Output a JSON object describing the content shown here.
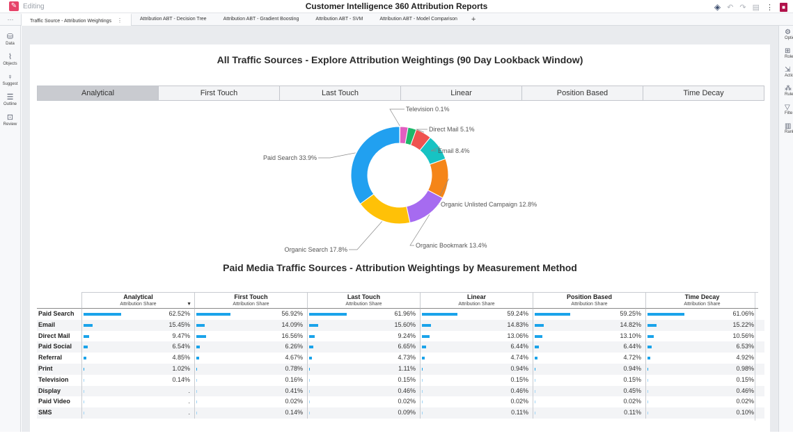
{
  "app": {
    "mode_label": "Editing",
    "title": "Customer Intelligence 360 Attribution Reports"
  },
  "tabs": [
    {
      "label": "Traffic Source - Attribution Weightings",
      "active": true
    },
    {
      "label": "Attribution ABT - Decision Tree",
      "active": false
    },
    {
      "label": "Attribution ABT - Gradient Boosting",
      "active": false
    },
    {
      "label": "Attribution ABT - SVM",
      "active": false
    },
    {
      "label": "Attribution ABT - Model Comparison",
      "active": false
    }
  ],
  "tab_add": "+",
  "left_rail": [
    {
      "icon": "data-icon",
      "glyph": "⛁",
      "label": "Data"
    },
    {
      "icon": "objects-icon",
      "glyph": "⌇",
      "label": "Objects"
    },
    {
      "icon": "suggest-icon",
      "glyph": "♀",
      "label": "Suggest"
    },
    {
      "icon": "outline-icon",
      "glyph": "☰",
      "label": "Outline"
    },
    {
      "icon": "review-icon",
      "glyph": "⊡",
      "label": "Review"
    }
  ],
  "right_rail": [
    {
      "icon": "options-icon",
      "glyph": "⚙",
      "label": "Optio"
    },
    {
      "icon": "roles-icon",
      "glyph": "⊞",
      "label": "Role"
    },
    {
      "icon": "actions-icon",
      "glyph": "⇲",
      "label": "Actio"
    },
    {
      "icon": "rules-icon",
      "glyph": "⁂",
      "label": "Rule"
    },
    {
      "icon": "filters-icon",
      "glyph": "▽",
      "label": "Filte"
    },
    {
      "icon": "ranks-icon",
      "glyph": "▥",
      "label": "Rank"
    }
  ],
  "report": {
    "title": "All Traffic Sources - Explore Attribution Weightings (90 Day Lookback Window)",
    "buttons": [
      "Analytical",
      "First Touch",
      "Last Touch",
      "Linear",
      "Position Based",
      "Time Decay"
    ],
    "selected_button": "Analytical",
    "table_title": "Paid Media Traffic Sources - Attribution Weightings by Measurement Method",
    "measure_label": "Attribution Share"
  },
  "chart_data": {
    "type": "pie",
    "donut": true,
    "slices": [
      {
        "label": "Paid Search",
        "value": 33.9,
        "display": "Paid Search 33.9%",
        "color": "#21a0f0"
      },
      {
        "label": "Organic Search",
        "value": 17.8,
        "display": "Organic Search 17.8%",
        "color": "#ffc107"
      },
      {
        "label": "Organic Bookmark",
        "value": 13.4,
        "display": "Organic Bookmark 13.4%",
        "color": "#a66bf0"
      },
      {
        "label": "Organic Unlisted Campaign",
        "value": 12.8,
        "display": "Organic Unlisted Campaign 12.8%",
        "color": "#f58518"
      },
      {
        "label": "Email",
        "value": 8.4,
        "display": "Email 8.4%",
        "color": "#17c3c3"
      },
      {
        "label": "Direct Mail",
        "value": 5.1,
        "display": "Direct Mail 5.1%",
        "color": "#ef5350"
      },
      {
        "label": "Other 1",
        "value": 2.7,
        "display": "",
        "color": "#1db86a"
      },
      {
        "label": "Other 2",
        "value": 2.6,
        "display": "",
        "color": "#e15fc0"
      },
      {
        "label": "Television",
        "value": 0.1,
        "display": "Television 0.1%",
        "color": "#c6d33a"
      }
    ]
  },
  "table": {
    "columns": [
      "Analytical",
      "First Touch",
      "Last Touch",
      "Linear",
      "Position Based",
      "Time Decay"
    ],
    "rows": [
      {
        "label": "Paid Search",
        "values": [
          "62.52%",
          "56.92%",
          "61.96%",
          "59.24%",
          "59.25%",
          "61.06%"
        ],
        "shares": [
          62.52,
          56.92,
          61.96,
          59.24,
          59.25,
          61.06
        ]
      },
      {
        "label": "Email",
        "values": [
          "15.45%",
          "14.09%",
          "15.60%",
          "14.83%",
          "14.82%",
          "15.22%"
        ],
        "shares": [
          15.45,
          14.09,
          15.6,
          14.83,
          14.82,
          15.22
        ]
      },
      {
        "label": "Direct Mail",
        "values": [
          "9.47%",
          "16.56%",
          "9.24%",
          "13.06%",
          "13.10%",
          "10.56%"
        ],
        "shares": [
          9.47,
          16.56,
          9.24,
          13.06,
          13.1,
          10.56
        ]
      },
      {
        "label": "Paid Social",
        "values": [
          "6.54%",
          "6.26%",
          "6.65%",
          "6.44%",
          "6.44%",
          "6.53%"
        ],
        "shares": [
          6.54,
          6.26,
          6.65,
          6.44,
          6.44,
          6.53
        ]
      },
      {
        "label": "Referral",
        "values": [
          "4.85%",
          "4.67%",
          "4.73%",
          "4.74%",
          "4.72%",
          "4.92%"
        ],
        "shares": [
          4.85,
          4.67,
          4.73,
          4.74,
          4.72,
          4.92
        ]
      },
      {
        "label": "Print",
        "values": [
          "1.02%",
          "0.78%",
          "1.11%",
          "0.94%",
          "0.94%",
          "0.98%"
        ],
        "shares": [
          1.02,
          0.78,
          1.11,
          0.94,
          0.94,
          0.98
        ]
      },
      {
        "label": "Television",
        "values": [
          "0.14%",
          "0.16%",
          "0.15%",
          "0.15%",
          "0.15%",
          "0.15%"
        ],
        "shares": [
          0.14,
          0.16,
          0.15,
          0.15,
          0.15,
          0.15
        ]
      },
      {
        "label": "Display",
        "values": [
          ".",
          "0.41%",
          "0.46%",
          "0.46%",
          "0.45%",
          "0.46%"
        ],
        "shares": [
          0,
          0.41,
          0.46,
          0.46,
          0.45,
          0.46
        ]
      },
      {
        "label": "Paid Video",
        "values": [
          ".",
          "0.02%",
          "0.02%",
          "0.02%",
          "0.02%",
          "0.02%"
        ],
        "shares": [
          0,
          0.02,
          0.02,
          0.02,
          0.02,
          0.02
        ]
      },
      {
        "label": "SMS",
        "values": [
          ".",
          "0.14%",
          "0.09%",
          "0.11%",
          "0.11%",
          "0.10%"
        ],
        "shares": [
          0,
          0.14,
          0.09,
          0.11,
          0.11,
          0.1
        ]
      }
    ]
  }
}
